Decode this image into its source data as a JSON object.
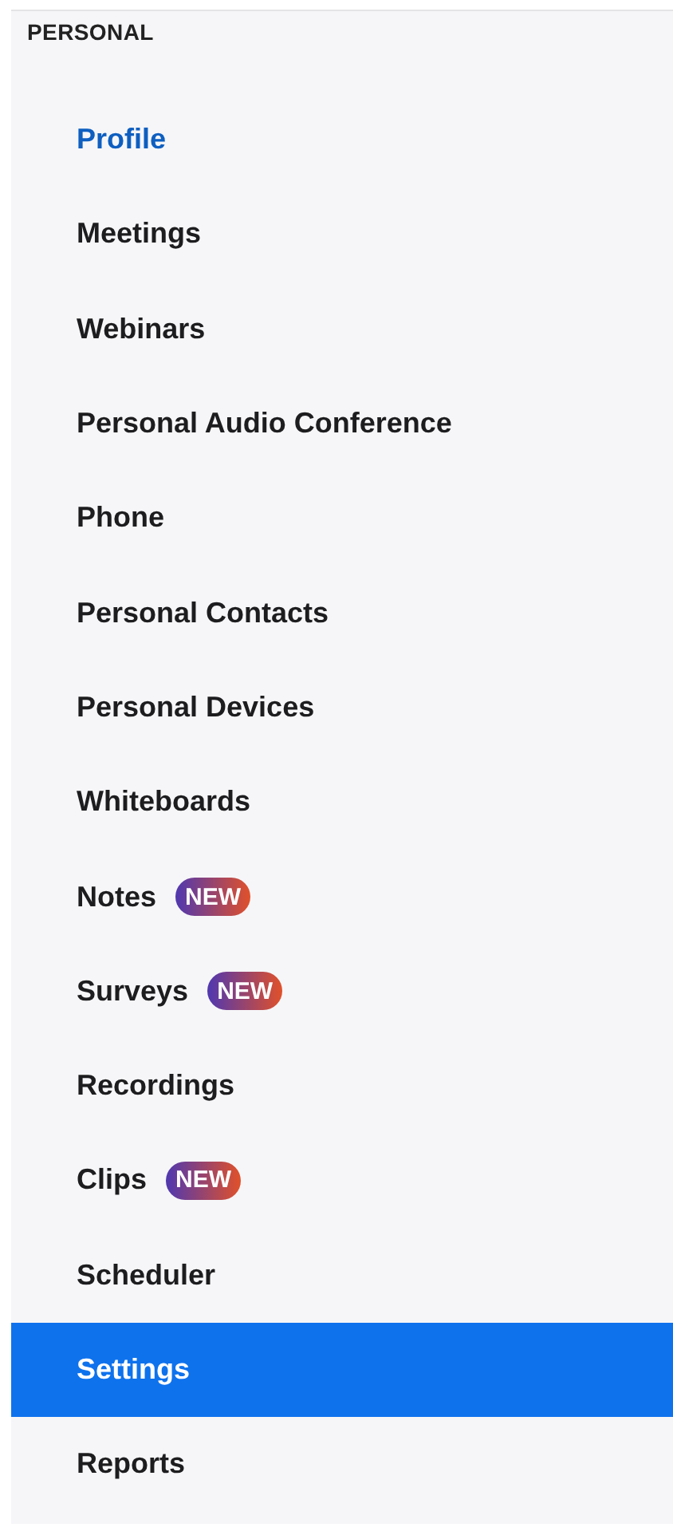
{
  "section": {
    "title": "PERSONAL"
  },
  "items": [
    {
      "label": "Profile",
      "selected": false,
      "current": true
    },
    {
      "label": "Meetings",
      "selected": false,
      "current": false
    },
    {
      "label": "Webinars",
      "selected": false,
      "current": false
    },
    {
      "label": "Personal Audio Conference",
      "selected": false,
      "current": false
    },
    {
      "label": "Phone",
      "selected": false,
      "current": false
    },
    {
      "label": "Personal Contacts",
      "selected": false,
      "current": false
    },
    {
      "label": "Personal Devices",
      "selected": false,
      "current": false
    },
    {
      "label": "Whiteboards",
      "selected": false,
      "current": false
    },
    {
      "label": "Notes",
      "selected": false,
      "current": false,
      "badge": "NEW"
    },
    {
      "label": "Surveys",
      "selected": false,
      "current": false,
      "badge": "NEW"
    },
    {
      "label": "Recordings",
      "selected": false,
      "current": false
    },
    {
      "label": "Clips",
      "selected": false,
      "current": false,
      "badge": "NEW"
    },
    {
      "label": "Scheduler",
      "selected": false,
      "current": false
    },
    {
      "label": "Settings",
      "selected": true,
      "current": false
    },
    {
      "label": "Reports",
      "selected": false,
      "current": false
    }
  ]
}
